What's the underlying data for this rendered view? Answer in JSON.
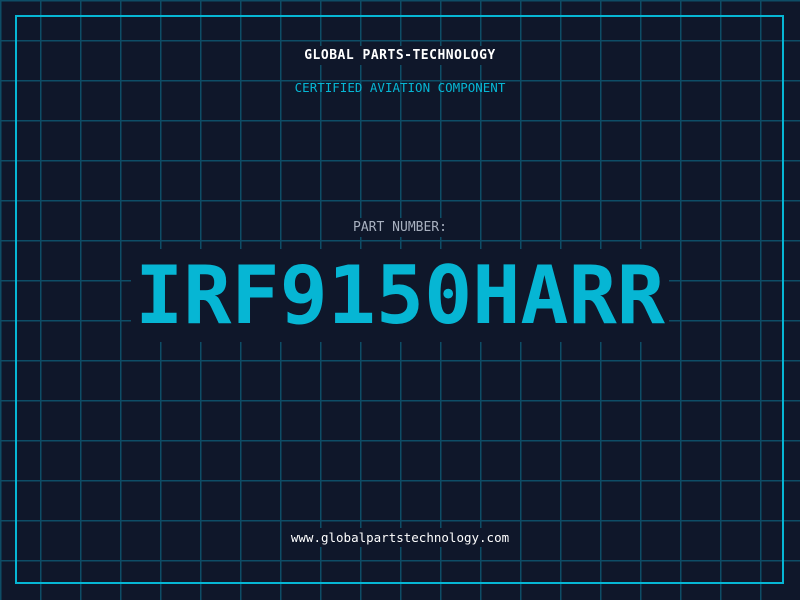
{
  "header": {
    "title": "GLOBAL PARTS-TECHNOLOGY",
    "subtitle": "CERTIFIED AVIATION COMPONENT"
  },
  "part": {
    "label": "PART NUMBER:",
    "number": "IRF9150HARR"
  },
  "footer": {
    "url": "www.globalpartstechnology.com"
  },
  "colors": {
    "background": "#0f172a",
    "grid": "#0e4d66",
    "accent": "#06b6d4",
    "text": "#ffffff",
    "label": "#a8b0bf"
  }
}
